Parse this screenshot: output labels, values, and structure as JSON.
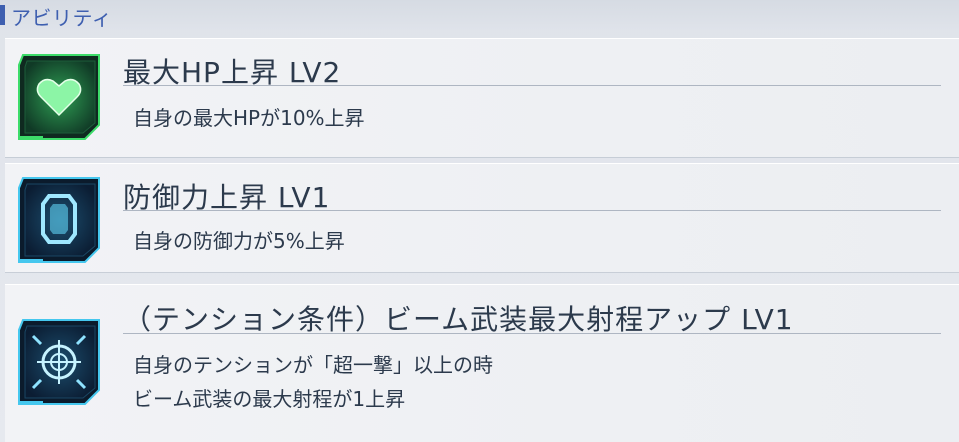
{
  "section": {
    "title": "アビリティ"
  },
  "abilities": [
    {
      "icon": "heart-icon",
      "accent": "#3ddc6a",
      "title": "最大HP上昇 LV2",
      "lines": [
        "自身の最大HPが10%上昇"
      ]
    },
    {
      "icon": "shield-icon",
      "accent": "#45c7ee",
      "title": "防御力上昇 LV1",
      "lines": [
        "自身の防御力が5%上昇"
      ]
    },
    {
      "icon": "crosshair-icon",
      "accent": "#45c7ee",
      "title": "（テンション条件）ビーム武装最大射程アップ LV1",
      "lines": [
        "自身のテンションが「超一撃」以上の時",
        "ビーム武装の最大射程が1上昇"
      ]
    }
  ]
}
